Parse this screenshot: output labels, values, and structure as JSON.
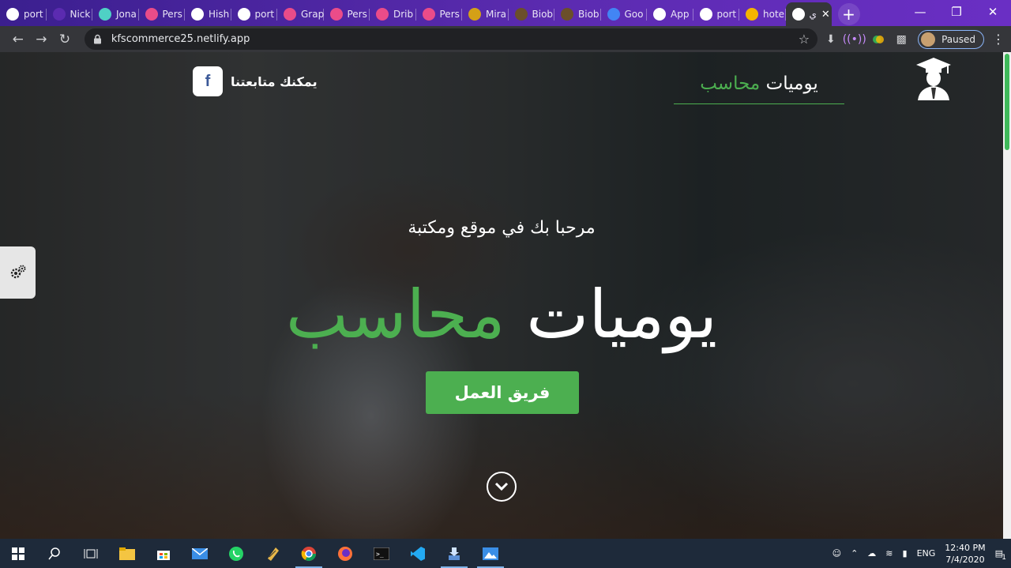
{
  "browser": {
    "tabs": [
      {
        "label": "port",
        "icon": "google-icon",
        "color": "#ffffff"
      },
      {
        "label": "Nick",
        "icon": "generic-favicon-icon",
        "color": "#5b2bb0"
      },
      {
        "label": "Jona",
        "icon": "teal-dot-icon",
        "color": "#4fd1c5"
      },
      {
        "label": "Pers",
        "icon": "dribbble-icon",
        "color": "#ea4c89"
      },
      {
        "label": "Hish",
        "icon": "globe-icon",
        "color": "#ffffff"
      },
      {
        "label": "port",
        "icon": "google-icon",
        "color": "#ffffff"
      },
      {
        "label": "Grap",
        "icon": "dribbble-icon",
        "color": "#ea4c89"
      },
      {
        "label": "Pers",
        "icon": "dribbble-icon",
        "color": "#ea4c89"
      },
      {
        "label": "Drib",
        "icon": "dribbble-icon",
        "color": "#ea4c89"
      },
      {
        "label": "Pers",
        "icon": "dribbble-icon",
        "color": "#ea4c89"
      },
      {
        "label": "Mira",
        "icon": "m-logo-icon",
        "color": "#d4a017"
      },
      {
        "label": "Biob",
        "icon": "book-icon",
        "color": "#6b4f2a"
      },
      {
        "label": "Biob",
        "icon": "book-icon",
        "color": "#6b4f2a"
      },
      {
        "label": "Goo",
        "icon": "google-translate-icon",
        "color": "#4285f4"
      },
      {
        "label": "App",
        "icon": "globe-icon",
        "color": "#ffffff"
      },
      {
        "label": "port",
        "icon": "globe-icon",
        "color": "#ffffff"
      },
      {
        "label": "hote",
        "icon": "crown-icon",
        "color": "#f5b400"
      },
      {
        "label": "ي",
        "icon": "site-favicon-icon",
        "color": "#ffffff"
      }
    ],
    "url": "kfscommerce25.netlify.app",
    "profile_label": "Paused"
  },
  "site": {
    "brand_plain": "يوميات",
    "brand_green": "محاسب",
    "follow_text": "يمكنك متابعتنا",
    "fb_letter": "f",
    "welcome": "مرحبا بك في موقع ومكتبة",
    "title_plain": "يوميات",
    "title_green": "محاسب",
    "team_button": "فريق العمل",
    "accent_color": "#4caf50"
  },
  "taskbar": {
    "lang": "ENG",
    "time": "12:40 PM",
    "date": "7/4/2020",
    "notification_count": "1"
  }
}
